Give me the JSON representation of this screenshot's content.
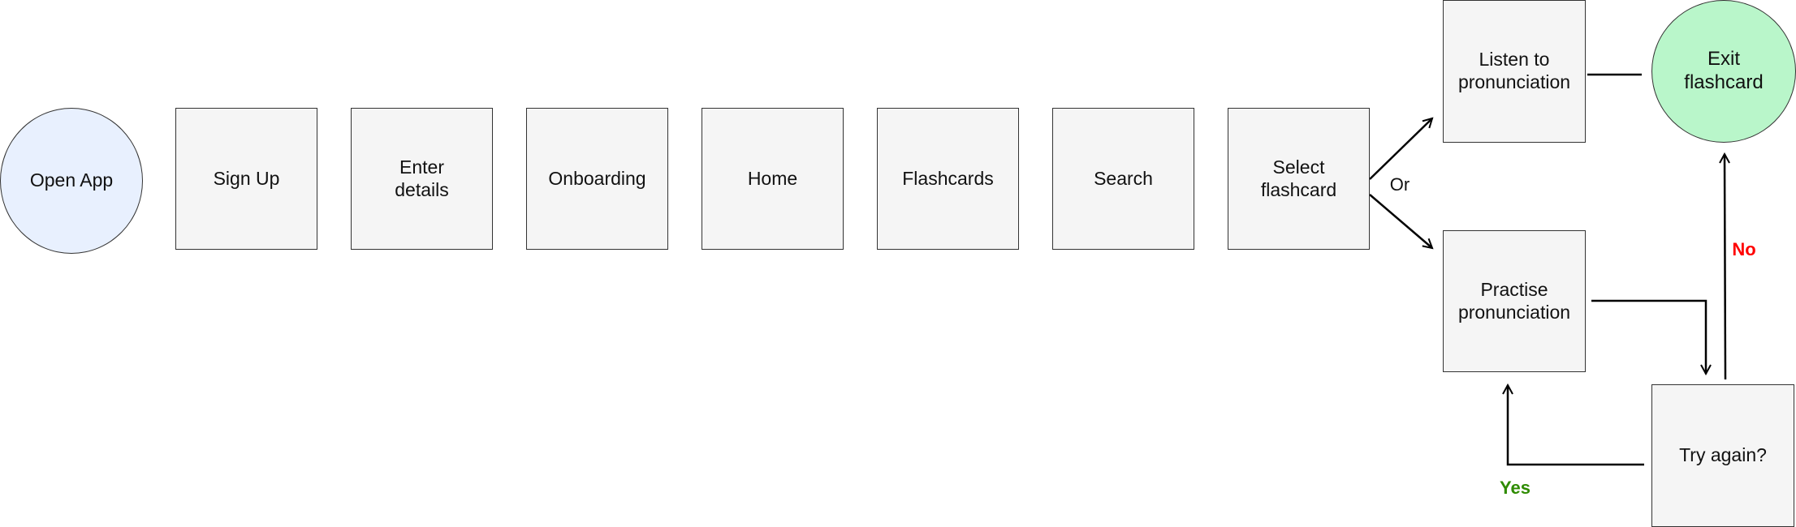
{
  "nodes": {
    "open_app": "Open App",
    "sign_up": "Sign Up",
    "enter_details": "Enter details",
    "onboarding": "Onboarding",
    "home": "Home",
    "flashcards": "Flashcards",
    "search": "Search",
    "select_flashcard": "Select flashcard",
    "listen": "Listen to pronunciation",
    "exit": "Exit flashcard",
    "practise": "Practise pronunciation",
    "try_again": "Try again?"
  },
  "labels": {
    "or": "Or",
    "no": "No",
    "yes": "Yes"
  },
  "colors": {
    "start_fill": "#e8f0fe",
    "end_fill": "#b9f6ca",
    "box_fill": "#f5f5f5",
    "no": "#ff0000",
    "yes": "#2e8b00"
  }
}
